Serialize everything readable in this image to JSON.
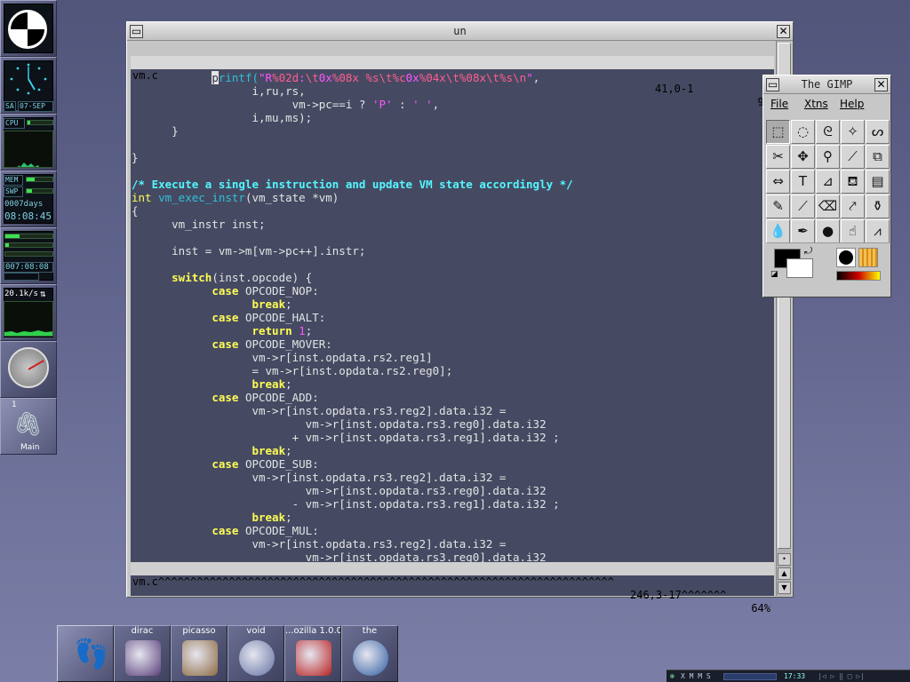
{
  "dock": {
    "calendar_day": "SA",
    "calendar_date": "07-SEP",
    "cpu_label": "CPU",
    "mem_label": "MEM",
    "swp_label": "SWP",
    "uptime_days": "0007days",
    "uptime_time": "08:08:45",
    "clock_readout": "007:08:08",
    "net_rate": "20.1k/s",
    "desk_number": "1",
    "workspace_name": "Main"
  },
  "terminal": {
    "title": "un",
    "status_top": {
      "file": "vm.c",
      "pos": "41,0-1",
      "pct": "9%"
    },
    "status_bottom": {
      "file": "vm.c^^^^^^^^^^^^^^^^^^^^^^^^^^^^^^^^^^^^^^^^^^^^^^^^^^^^^^^^^^^^^^^^^^^^^^^",
      "pos": "246,3-17^^^^^^^",
      "pct": "64%"
    },
    "code_lines": [
      [
        [
          "            ",
          ""
        ],
        [
          "p",
          "cur"
        ],
        [
          "rintf(",
          "fn"
        ],
        [
          "\"R",
          "st"
        ],
        [
          "%02d",
          "es"
        ],
        [
          ":",
          "st"
        ],
        [
          "\\t",
          "es"
        ],
        [
          "0x",
          "st"
        ],
        [
          "%08x",
          "es"
        ],
        [
          " ",
          "st"
        ],
        [
          "%s",
          "es"
        ],
        [
          "\\t",
          "es"
        ],
        [
          "%c",
          "es"
        ],
        [
          "0x",
          "st"
        ],
        [
          "%04x",
          "es"
        ],
        [
          "\\t",
          "es"
        ],
        [
          "%08x",
          "es"
        ],
        [
          "\\t",
          "es"
        ],
        [
          "%s",
          "es"
        ],
        [
          "\\n",
          "es"
        ],
        [
          "\"",
          "st"
        ],
        [
          ",",
          ""
        ]
      ],
      [
        [
          "                  i,ru,rs,",
          ""
        ]
      ],
      [
        [
          "                        vm->pc==i ? ",
          ""
        ],
        [
          "'P'",
          "st"
        ],
        [
          " : ",
          ""
        ],
        [
          "' '",
          "st"
        ],
        [
          ",",
          ""
        ]
      ],
      [
        [
          "                  i,mu,ms);",
          ""
        ]
      ],
      [
        [
          "      }",
          ""
        ]
      ],
      [
        [
          "",
          ""
        ]
      ],
      [
        [
          "}",
          ""
        ]
      ],
      [
        [
          "",
          ""
        ]
      ],
      [
        [
          "/* Execute a single instruction and update VM state accordingly */",
          "cm"
        ]
      ],
      [
        [
          "int",
          "ty"
        ],
        [
          " ",
          ""
        ],
        [
          "vm_exec_instr",
          "fn"
        ],
        [
          "(vm_state *vm)",
          ""
        ]
      ],
      [
        [
          "{",
          ""
        ]
      ],
      [
        [
          "      vm_instr inst;",
          ""
        ]
      ],
      [
        [
          "",
          ""
        ]
      ],
      [
        [
          "      inst = vm->m[vm->pc++].instr;",
          ""
        ]
      ],
      [
        [
          "",
          ""
        ]
      ],
      [
        [
          "      ",
          ""
        ],
        [
          "switch",
          "kw"
        ],
        [
          "(inst.opcode) {",
          ""
        ]
      ],
      [
        [
          "            ",
          ""
        ],
        [
          "case",
          "kw"
        ],
        [
          " OPCODE_NOP:",
          ""
        ]
      ],
      [
        [
          "                  ",
          ""
        ],
        [
          "break",
          "kw"
        ],
        [
          ";",
          ""
        ]
      ],
      [
        [
          "            ",
          ""
        ],
        [
          "case",
          "kw"
        ],
        [
          " OPCODE_HALT:",
          ""
        ]
      ],
      [
        [
          "                  ",
          ""
        ],
        [
          "return",
          "kw"
        ],
        [
          " ",
          ""
        ],
        [
          "1",
          "nu"
        ],
        [
          ";",
          ""
        ]
      ],
      [
        [
          "            ",
          ""
        ],
        [
          "case",
          "kw"
        ],
        [
          " OPCODE_MOVER:",
          ""
        ]
      ],
      [
        [
          "                  vm->r[inst.opdata.rs2.reg1]",
          ""
        ]
      ],
      [
        [
          "                  = vm->r[inst.opdata.rs2.reg0];",
          ""
        ]
      ],
      [
        [
          "                  ",
          ""
        ],
        [
          "break",
          "kw"
        ],
        [
          ";",
          ""
        ]
      ],
      [
        [
          "            ",
          ""
        ],
        [
          "case",
          "kw"
        ],
        [
          " OPCODE_ADD:",
          ""
        ]
      ],
      [
        [
          "                  vm->r[inst.opdata.rs3.reg2].data.i32 =",
          ""
        ]
      ],
      [
        [
          "                          vm->r[inst.opdata.rs3.reg0].data.i32",
          ""
        ]
      ],
      [
        [
          "                        + vm->r[inst.opdata.rs3.reg1].data.i32 ;",
          ""
        ]
      ],
      [
        [
          "                  ",
          ""
        ],
        [
          "break",
          "kw"
        ],
        [
          ";",
          ""
        ]
      ],
      [
        [
          "            ",
          ""
        ],
        [
          "case",
          "kw"
        ],
        [
          " OPCODE_SUB:",
          ""
        ]
      ],
      [
        [
          "                  vm->r[inst.opdata.rs3.reg2].data.i32 =",
          ""
        ]
      ],
      [
        [
          "                          vm->r[inst.opdata.rs3.reg0].data.i32",
          ""
        ]
      ],
      [
        [
          "                        - vm->r[inst.opdata.rs3.reg1].data.i32 ;",
          ""
        ]
      ],
      [
        [
          "                  ",
          ""
        ],
        [
          "break",
          "kw"
        ],
        [
          ";",
          ""
        ]
      ],
      [
        [
          "            ",
          ""
        ],
        [
          "case",
          "kw"
        ],
        [
          " OPCODE_MUL:",
          ""
        ]
      ],
      [
        [
          "                  vm->r[inst.opdata.rs3.reg2].data.i32 =",
          ""
        ]
      ],
      [
        [
          "                          vm->r[inst.opdata.rs3.reg0].data.i32",
          ""
        ]
      ]
    ]
  },
  "gimp": {
    "title": "The GIMP",
    "menu": [
      "File",
      "Xtns",
      "Help"
    ],
    "tools": [
      {
        "name": "rect-select-tool-icon",
        "glyph": "⬚"
      },
      {
        "name": "ellipse-select-tool-icon",
        "glyph": "◌"
      },
      {
        "name": "free-select-tool-icon",
        "glyph": "ᘓ"
      },
      {
        "name": "fuzzy-select-tool-icon",
        "glyph": "✧"
      },
      {
        "name": "bezier-select-tool-icon",
        "glyph": "ᔕ"
      },
      {
        "name": "scissors-tool-icon",
        "glyph": "✂"
      },
      {
        "name": "move-tool-icon",
        "glyph": "✥"
      },
      {
        "name": "magnify-tool-icon",
        "glyph": "⚲"
      },
      {
        "name": "crop-tool-icon",
        "glyph": "⟋"
      },
      {
        "name": "transform-tool-icon",
        "glyph": "⧉"
      },
      {
        "name": "flip-tool-icon",
        "glyph": "⇔"
      },
      {
        "name": "text-tool-icon",
        "glyph": "T"
      },
      {
        "name": "color-picker-tool-icon",
        "glyph": "⊿"
      },
      {
        "name": "bucket-fill-tool-icon",
        "glyph": "⛾"
      },
      {
        "name": "blend-tool-icon",
        "glyph": "▤"
      },
      {
        "name": "pencil-tool-icon",
        "glyph": "✎"
      },
      {
        "name": "paintbrush-tool-icon",
        "glyph": "⟋"
      },
      {
        "name": "eraser-tool-icon",
        "glyph": "⌫"
      },
      {
        "name": "airbrush-tool-icon",
        "glyph": "⤤"
      },
      {
        "name": "clone-tool-icon",
        "glyph": "⚱"
      },
      {
        "name": "convolve-tool-icon",
        "glyph": "💧"
      },
      {
        "name": "ink-tool-icon",
        "glyph": "✒"
      },
      {
        "name": "dodge-burn-tool-icon",
        "glyph": "●"
      },
      {
        "name": "smudge-tool-icon",
        "glyph": "☝"
      },
      {
        "name": "measure-tool-icon",
        "glyph": "⩘"
      }
    ],
    "fg_color": "#000000",
    "bg_color": "#ffffff"
  },
  "launcher": [
    {
      "label": "dirac",
      "icon": "dirac-app-icon",
      "color": "#5a3f7a"
    },
    {
      "label": "picasso",
      "icon": "picasso-app-icon",
      "color": "#8c6a40"
    },
    {
      "label": "void",
      "icon": "void-app-icon",
      "color": "#6070a0"
    },
    {
      "label": "...ozilla 1.0.0",
      "icon": "mozilla-app-icon",
      "color": "#b82020"
    },
    {
      "label": "the",
      "icon": "globe-app-icon",
      "color": "#2d5aa0"
    }
  ],
  "xmms": {
    "label": "X M M S",
    "time": "17:33"
  }
}
